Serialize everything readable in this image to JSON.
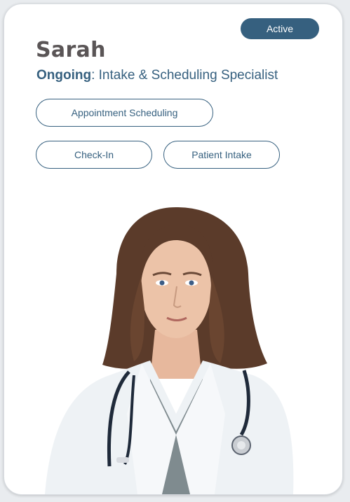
{
  "profile": {
    "name": "Sarah",
    "status": "Active",
    "role_status": "Ongoing",
    "role_separator": ":",
    "role_title": "Intake & Scheduling Specialist"
  },
  "skills": [
    {
      "label": "Appointment Scheduling"
    },
    {
      "label": "Check-In"
    },
    {
      "label": "Patient Intake"
    }
  ],
  "colors": {
    "accent": "#36607f",
    "name_text": "#5a5556",
    "badge_text": "#ffffff"
  }
}
